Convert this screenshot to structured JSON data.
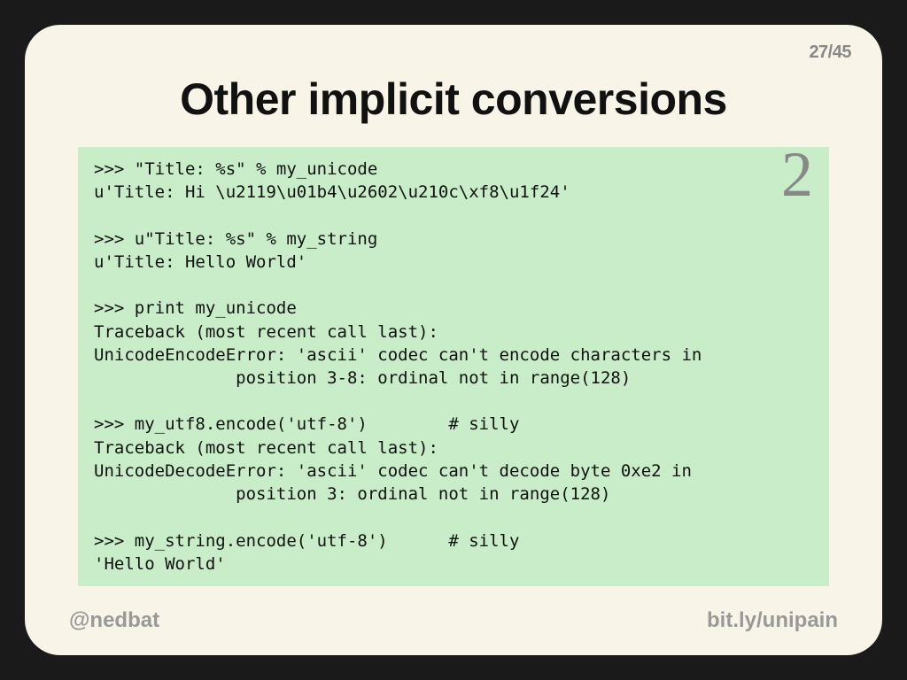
{
  "page_counter": "27/45",
  "title": "Other implicit conversions",
  "python_version_badge": "2",
  "code": ">>> \"Title: %s\" % my_unicode\nu'Title: Hi \\u2119\\u01b4\\u2602\\u210c\\xf8\\u1f24'\n\n>>> u\"Title: %s\" % my_string\nu'Title: Hello World'\n\n>>> print my_unicode\nTraceback (most recent call last):\nUnicodeEncodeError: 'ascii' codec can't encode characters in\n              position 3-8: ordinal not in range(128)\n\n>>> my_utf8.encode('utf-8')        # silly\nTraceback (most recent call last):\nUnicodeDecodeError: 'ascii' codec can't decode byte 0xe2 in\n              position 3: ordinal not in range(128)\n\n>>> my_string.encode('utf-8')      # silly\n'Hello World'",
  "footer": {
    "left": "@nedbat",
    "right": "bit.ly/unipain"
  }
}
